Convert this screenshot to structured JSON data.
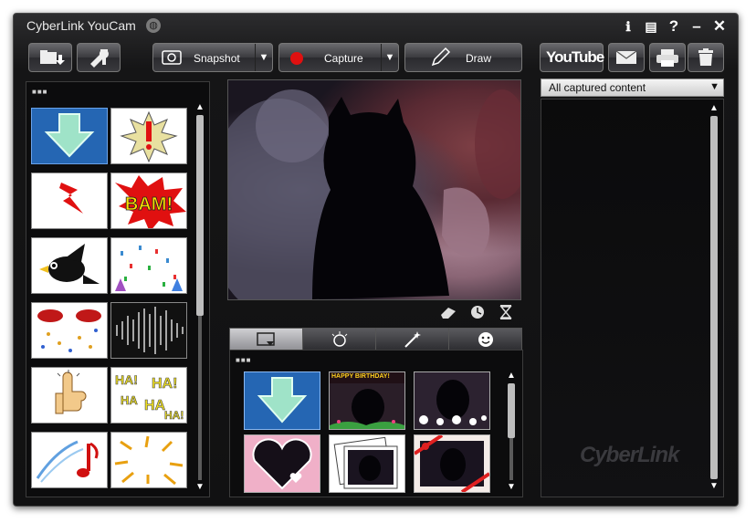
{
  "window": {
    "title": "CyberLink YouCam",
    "title_icon": "globe-icon",
    "controls": [
      "info-icon",
      "settings-icon",
      "help-icon",
      "minimize-icon",
      "close-icon"
    ]
  },
  "toolbar": {
    "snapshot_label": "Snapshot",
    "capture_label": "Capture",
    "draw_label": "Draw",
    "youtube_label": "YouTube",
    "left_icons": [
      "open-folder-icon",
      "tools-icon"
    ],
    "right_icons": [
      "email-icon",
      "print-icon",
      "trash-icon"
    ]
  },
  "left_panel": {
    "header": "■■■",
    "tiles": [
      {
        "name": "download-arrow-icon",
        "selected": true
      },
      {
        "name": "exclamation-burst-icon"
      },
      {
        "name": "lightning-bolt-icon"
      },
      {
        "name": "bam-comic-icon"
      },
      {
        "name": "bird-icon"
      },
      {
        "name": "confetti-icon"
      },
      {
        "name": "lips-confetti-icon"
      },
      {
        "name": "sound-wave-icon"
      },
      {
        "name": "thumbs-up-icon"
      },
      {
        "name": "haha-text-icon"
      },
      {
        "name": "music-note-icon"
      },
      {
        "name": "sparks-icon"
      }
    ]
  },
  "video": {
    "controls": [
      "eraser-icon",
      "clock-icon",
      "hourglass-icon"
    ]
  },
  "effects": {
    "tabs": [
      "frame-tab-icon",
      "emotion-tab-icon",
      "magic-wand-tab-icon",
      "smiley-tab-icon"
    ],
    "header": "■■■",
    "birthday_text": "HAPPY BIRTHDAY!",
    "thumbnails": [
      "download-arrow-effect",
      "happy-birthday-effect",
      "bubbles-effect",
      "heart-frame-effect",
      "photo-stack-effect",
      "ribbon-frame-effect"
    ]
  },
  "right_panel": {
    "filter_label": "All captured content",
    "watermark": "CyberLink"
  }
}
